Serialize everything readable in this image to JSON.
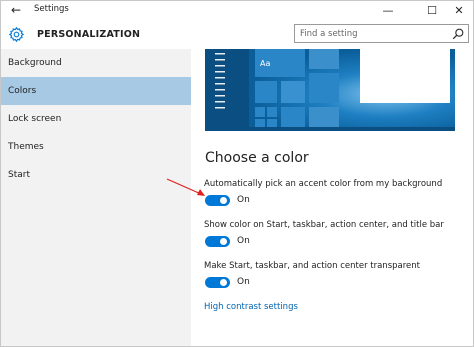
{
  "titlebar": {
    "back_icon": "back-arrow-icon",
    "title": "Settings",
    "minimize": "—",
    "maximize": "☐",
    "close": "✕"
  },
  "header": {
    "icon": "gear-icon",
    "title": "PERSONALIZATION",
    "search_placeholder": "Find a setting"
  },
  "sidebar": {
    "items": [
      {
        "label": "Background",
        "selected": false
      },
      {
        "label": "Colors",
        "selected": true
      },
      {
        "label": "Lock screen",
        "selected": false
      },
      {
        "label": "Themes",
        "selected": false
      },
      {
        "label": "Start",
        "selected": false
      }
    ]
  },
  "main": {
    "preview_tile_text": "Aa",
    "heading": "Choose a color",
    "options": [
      {
        "label": "Automatically pick an accent color from my background",
        "state": "On"
      },
      {
        "label": "Show color on Start, taskbar, action center, and title bar",
        "state": "On"
      },
      {
        "label": "Make Start, taskbar, and action center transparent",
        "state": "On"
      }
    ],
    "link": "High contrast settings"
  },
  "colors": {
    "accent": "#0078d7",
    "selected_nav": "#a7c9e4",
    "sidebar_bg": "#f2f2f2",
    "link": "#0063b1",
    "annotation_arrow": "#e02020"
  }
}
